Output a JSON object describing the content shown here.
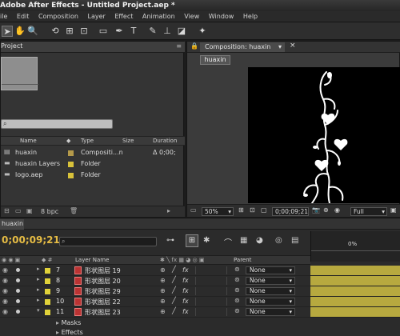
{
  "window": {
    "title": "Adobe After Effects - Untitled Project.aep *"
  },
  "menu": [
    "ile",
    "Edit",
    "Composition",
    "Layer",
    "Effect",
    "Animation",
    "View",
    "Window",
    "Help"
  ],
  "project": {
    "tab": "Project",
    "columns": {
      "name": "Name",
      "type": "Type",
      "size": "Size",
      "duration": "Duration"
    },
    "items": [
      {
        "name": "huaxin",
        "type": "Compositi...n",
        "duration": "Δ 0;00;",
        "label_color": "#b59a4a"
      },
      {
        "name": "huaxin Layers",
        "type": "Folder",
        "duration": "",
        "label_color": "#d8c23a"
      },
      {
        "name": "logo.aep",
        "type": "Folder",
        "duration": "",
        "label_color": "#d8c23a"
      }
    ],
    "bpc": "8 bpc"
  },
  "composition": {
    "tab": "Composition: huaxin",
    "breadcrumb": "huaxin",
    "zoom": "50%",
    "timecode": "0;00;09;21",
    "resolution": "Full"
  },
  "timeline": {
    "tab": "huaxin",
    "current_time": "0;00;09;21",
    "columns": {
      "layer_name": "Layer Name",
      "parent": "Parent"
    },
    "ruler_label": "0%",
    "layers": [
      {
        "num": "7",
        "name": "形状图层 19",
        "parent": "None"
      },
      {
        "num": "8",
        "name": "形状图层 20",
        "parent": "None"
      },
      {
        "num": "9",
        "name": "形状图层 29",
        "parent": "None"
      },
      {
        "num": "10",
        "name": "形状图层 22",
        "parent": "None"
      },
      {
        "num": "11",
        "name": "形状图层 23",
        "parent": "None"
      }
    ],
    "sub_items": [
      "Masks",
      "Effects"
    ]
  }
}
